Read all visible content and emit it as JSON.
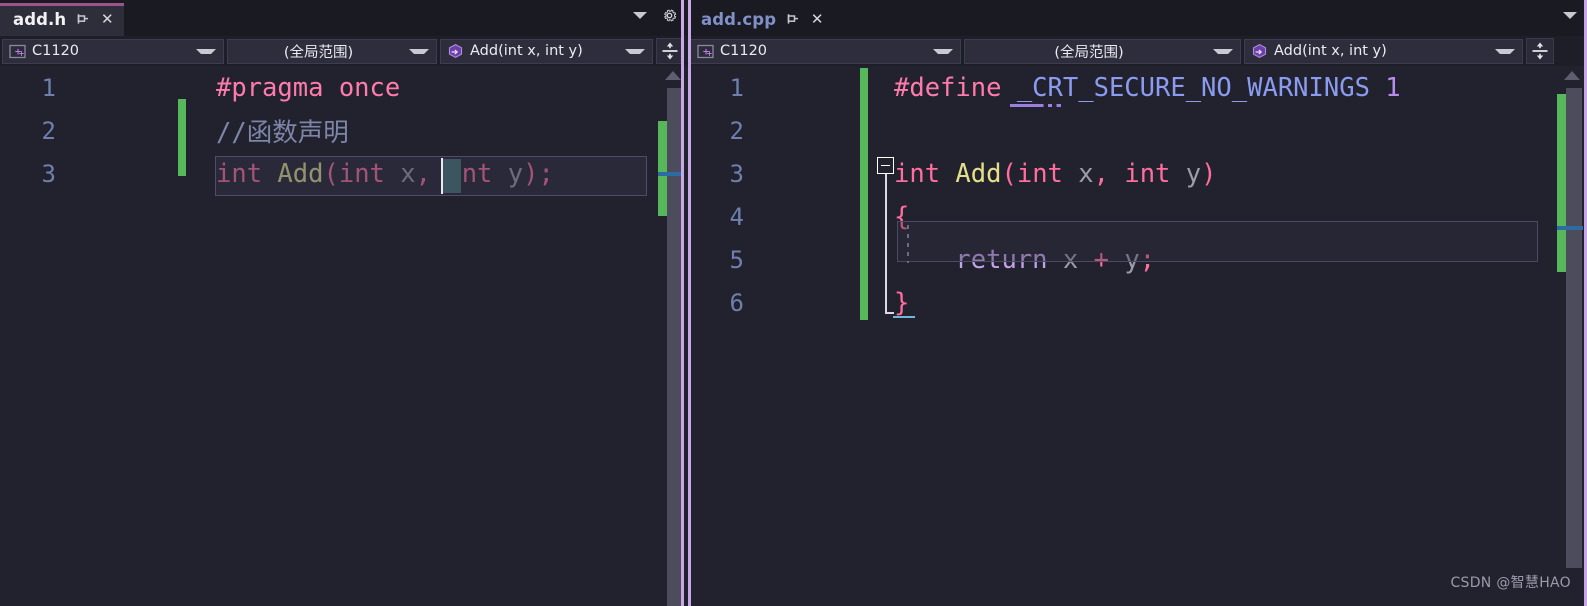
{
  "app": {
    "theme_bg": "#22222e",
    "accent": "#a0528c",
    "watermark": "CSDN @智慧HAO"
  },
  "left_pane": {
    "tab": {
      "title": "add.h",
      "pin_icon": "pin-icon",
      "close_icon": "close-icon",
      "active": true
    },
    "tabstrip_controls": {
      "overflow_icon": "chevron-down-icon",
      "settings_icon": "gear-icon"
    },
    "navbar": {
      "project": {
        "label": "C1120",
        "icon": "cpp-project-icon"
      },
      "scope": {
        "label": "(全局范围)"
      },
      "member": {
        "label": "Add(int x, int y)",
        "icon": "method-cube-icon"
      },
      "split_icon": "split-horizontal-icon"
    },
    "code": {
      "lines": [
        {
          "n": "1",
          "tokens": [
            {
              "t": "#pragma once",
              "c": "t-pp"
            }
          ]
        },
        {
          "n": "2",
          "tokens": [
            {
              "t": "//函数声明",
              "c": "t-cmt"
            }
          ]
        },
        {
          "n": "3",
          "tokens": [
            {
              "t": "int",
              "c": "t-kw"
            },
            {
              "t": " ",
              "c": "t-var"
            },
            {
              "t": "Add",
              "c": "t-fn"
            },
            {
              "t": "(",
              "c": "t-punct"
            },
            {
              "t": "int",
              "c": "t-kw"
            },
            {
              "t": " ",
              "c": "t-var"
            },
            {
              "t": "x",
              "c": "t-var"
            },
            {
              "t": ",",
              "c": "t-punct"
            },
            {
              "t": " ",
              "c": "t-var"
            },
            {
              "t": "int",
              "c": "t-kw"
            },
            {
              "t": " ",
              "c": "t-var"
            },
            {
              "t": "y",
              "c": "t-var"
            },
            {
              "t": ");",
              "c": "t-punct"
            }
          ]
        }
      ]
    },
    "scrollbar": {
      "has_change_bar": true,
      "has_caret_mark": true
    }
  },
  "right_pane": {
    "tab": {
      "title": "add.cpp",
      "pin_icon": "pin-icon",
      "close_icon": "close-icon",
      "active": false
    },
    "tabstrip_controls": {
      "overflow_icon": "chevron-down-icon"
    },
    "navbar": {
      "project": {
        "label": "C1120",
        "icon": "cpp-project-icon"
      },
      "scope": {
        "label": "(全局范围)"
      },
      "member": {
        "label": "Add(int x, int y)",
        "icon": "method-cube-icon"
      },
      "split_icon": "split-horizontal-icon"
    },
    "code": {
      "lines": [
        {
          "n": "1",
          "tokens": [
            {
              "t": "#define",
              "c": "t-pp"
            },
            {
              "t": " ",
              "c": "t-var"
            },
            {
              "t": "_CRT_SECURE_NO_WARNINGS",
              "c": "t-macro"
            },
            {
              "t": " ",
              "c": "t-var"
            },
            {
              "t": "1",
              "c": "t-num"
            }
          ]
        },
        {
          "n": "2",
          "tokens": []
        },
        {
          "n": "3",
          "tokens": [
            {
              "t": "int",
              "c": "t-kw"
            },
            {
              "t": " ",
              "c": "t-var"
            },
            {
              "t": "Add",
              "c": "t-fn"
            },
            {
              "t": "(",
              "c": "t-punct"
            },
            {
              "t": "int",
              "c": "t-kw"
            },
            {
              "t": " ",
              "c": "t-var"
            },
            {
              "t": "x",
              "c": "t-var"
            },
            {
              "t": ",",
              "c": "t-punct"
            },
            {
              "t": " ",
              "c": "t-var"
            },
            {
              "t": "int",
              "c": "t-kw"
            },
            {
              "t": " ",
              "c": "t-var"
            },
            {
              "t": "y",
              "c": "t-var"
            },
            {
              "t": ")",
              "c": "t-punct"
            }
          ]
        },
        {
          "n": "4",
          "tokens": [
            {
              "t": "{",
              "c": "t-punct"
            }
          ]
        },
        {
          "n": "5",
          "tokens": [
            {
              "t": "    ",
              "c": "t-var"
            },
            {
              "t": "return",
              "c": "t-ret"
            },
            {
              "t": " ",
              "c": "t-var"
            },
            {
              "t": "x",
              "c": "t-var"
            },
            {
              "t": " ",
              "c": "t-var"
            },
            {
              "t": "+",
              "c": "t-punct"
            },
            {
              "t": " ",
              "c": "t-var"
            },
            {
              "t": "y",
              "c": "t-var"
            },
            {
              "t": ";",
              "c": "t-punct"
            }
          ]
        },
        {
          "n": "6",
          "tokens": [
            {
              "t": "}",
              "c": "t-punct"
            }
          ]
        }
      ]
    },
    "fold": {
      "icon": "collapse-minus-icon",
      "line": "3"
    },
    "scrollbar": {
      "has_change_bar": true,
      "has_caret_mark": true
    }
  }
}
